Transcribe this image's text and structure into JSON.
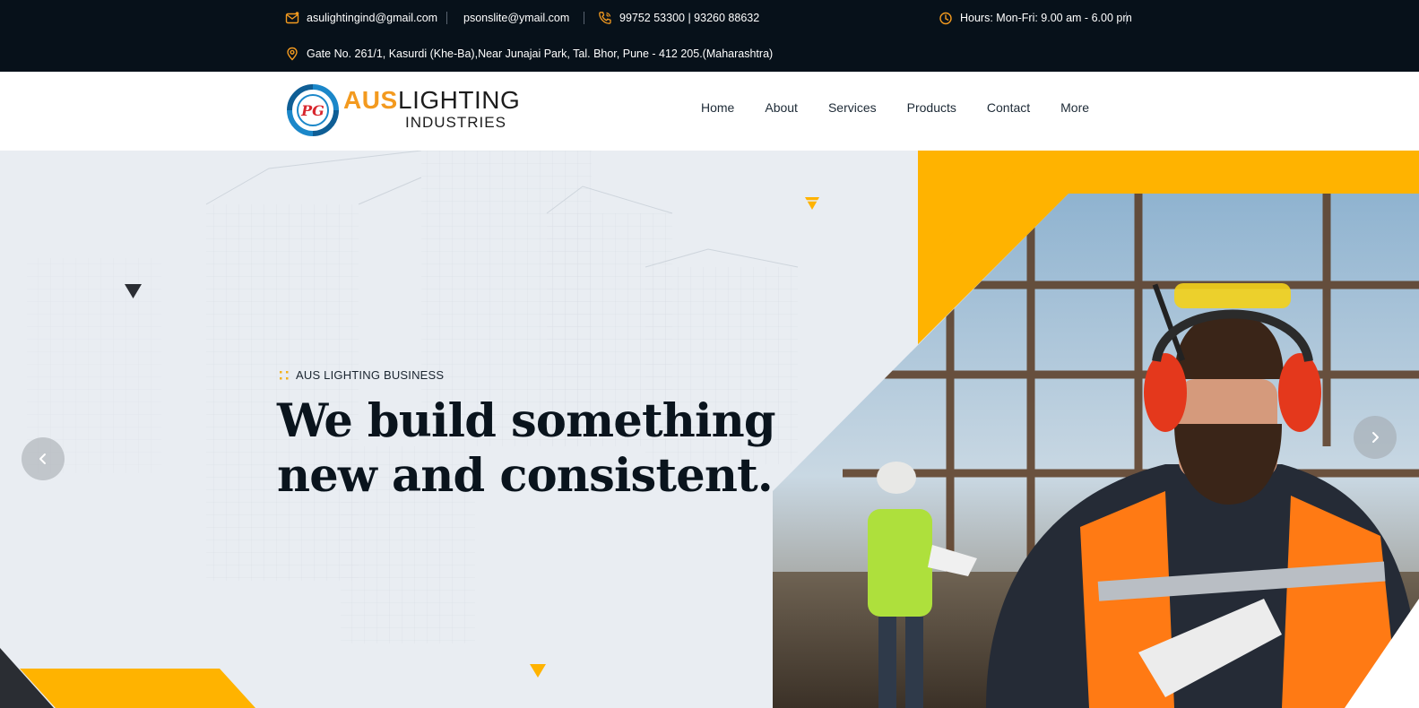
{
  "topbar": {
    "email_primary": "asulightingind@gmail.com",
    "email_secondary": "psonslite@ymail.com",
    "phone": "99752 53300 | 93260 88632",
    "hours": "Hours: Mon-Fri: 9.00 am - 6.00 pm",
    "address": "Gate No. 261/1, Kasurdi (Khe-Ba),Near Junajai Park, Tal. Bhor, Pune - 412 205.(Maharashtra)",
    "icons": {
      "email": "mail-icon",
      "phone": "phone-icon",
      "hours": "clock-icon",
      "address": "location-pin-icon"
    }
  },
  "logo": {
    "mark_text": "PG",
    "word_accent": "AUS",
    "word_main": "LIGHTING",
    "word_sub": "INDUSTRIES"
  },
  "nav": {
    "items": [
      "Home",
      "About",
      "Services",
      "Products",
      "Contact",
      "More"
    ]
  },
  "hero": {
    "eyebrow": "AUS LIGHTING BUSINESS",
    "headline_line1": "We build something",
    "headline_line2": "new and consistent.",
    "prev_icon": "chevron-left-icon",
    "next_icon": "chevron-right-icon",
    "image": "construction-worker-photo"
  },
  "colors": {
    "topbar_bg": "#07111a",
    "accent_orange": "#f39a1f",
    "accent_yellow": "#ffb300",
    "hero_bg": "#e9edf2",
    "text_dark": "#0a141d"
  }
}
